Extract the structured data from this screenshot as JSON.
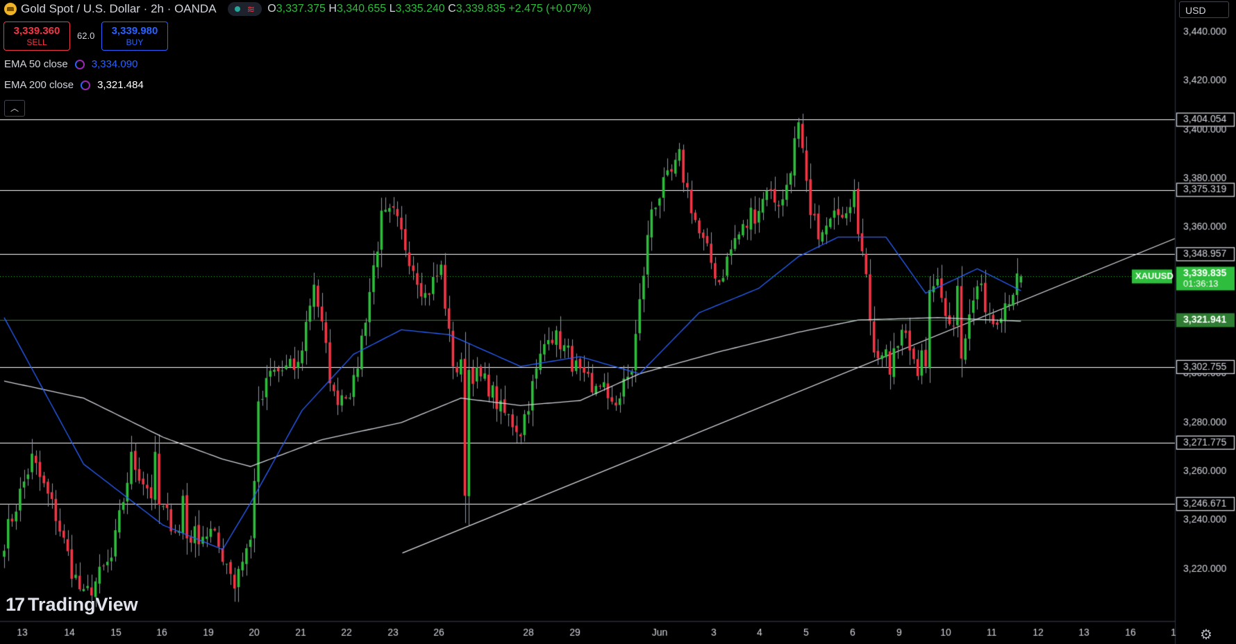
{
  "header": {
    "symbol_title": "Gold Spot / U.S. Dollar · 2h · OANDA",
    "ohlc": {
      "o_label": "O",
      "o": "3,337.375",
      "h_label": "H",
      "h": "3,340.655",
      "l_label": "L",
      "l": "3,335.240",
      "c_label": "C",
      "c": "3,339.835",
      "change": "+2.475 (+0.07%)"
    }
  },
  "trade": {
    "sell_price": "3,339.360",
    "sell_label": "SELL",
    "spread": "62.0",
    "buy_price": "3,339.980",
    "buy_label": "BUY"
  },
  "indicators": [
    {
      "label": "EMA 50 close",
      "value": "3,334.090",
      "color": "#2962ff"
    },
    {
      "label": "EMA 200 close",
      "value": "3,321.484",
      "color": "#d1d4dc"
    }
  ],
  "collapse_icon": "chevron-up-icon",
  "currency": "USD",
  "watermark": "TradingView",
  "settings_icon": "gear-icon",
  "colors": {
    "up": "#2ebd3c",
    "down": "#f23645",
    "ema50": "#2962ff",
    "ema200": "#d1d4dc",
    "level": "#ffffff",
    "price": "#2ebd3c"
  },
  "chart_data": {
    "type": "candlestick",
    "symbol": "XAUUSD",
    "ylim": [
      3200,
      3450
    ],
    "y_ticks": [
      "3,220.000",
      "3,240.000",
      "3,260.000",
      "3,280.000",
      "3,300.000",
      "3,360.000",
      "3,380.000",
      "3,400.000",
      "3,420.000",
      "3,440.000"
    ],
    "x_ticks": [
      "13",
      "14",
      "15",
      "16",
      "19",
      "20",
      "21",
      "22",
      "23",
      "26",
      "28",
      "29",
      "Jun",
      "3",
      "4",
      "5",
      "6",
      "9",
      "10",
      "11",
      "12",
      "13",
      "16",
      "1"
    ],
    "levels": [
      {
        "value": 3404.054,
        "label": "3,404.054"
      },
      {
        "value": 3375.319,
        "label": "3,375.319"
      },
      {
        "value": 3348.957,
        "label": "3,348.957"
      },
      {
        "value": 3321.941,
        "label": "3,321.941",
        "highlight": true
      },
      {
        "value": 3302.755,
        "label": "3,302.755"
      },
      {
        "value": 3271.775,
        "label": "3,271.775"
      },
      {
        "value": 3246.671,
        "label": "3,246.671"
      }
    ],
    "current_price": {
      "value": 3339.835,
      "label": "3,339.835",
      "countdown": "01:36:13",
      "symbol": "XAUUSD"
    },
    "trendline": {
      "from": {
        "bar": 116,
        "price": 3237
      },
      "to": {
        "bar": 267,
        "price": 3337
      }
    },
    "ema50_anchors": [
      [
        0,
        3323
      ],
      [
        20,
        3263
      ],
      [
        40,
        3238
      ],
      [
        55,
        3228
      ],
      [
        62,
        3247
      ],
      [
        75,
        3285
      ],
      [
        88,
        3308
      ],
      [
        100,
        3318
      ],
      [
        112,
        3316
      ],
      [
        130,
        3303
      ],
      [
        145,
        3307
      ],
      [
        160,
        3300
      ],
      [
        175,
        3325
      ],
      [
        190,
        3335
      ],
      [
        200,
        3348
      ],
      [
        210,
        3356
      ],
      [
        222,
        3356
      ],
      [
        232,
        3333
      ],
      [
        245,
        3343
      ],
      [
        256,
        3334
      ]
    ],
    "ema200_anchors": [
      [
        0,
        3297
      ],
      [
        20,
        3290
      ],
      [
        40,
        3274
      ],
      [
        55,
        3265
      ],
      [
        62,
        3262
      ],
      [
        80,
        3273
      ],
      [
        100,
        3280
      ],
      [
        115,
        3290
      ],
      [
        130,
        3287
      ],
      [
        145,
        3289
      ],
      [
        160,
        3300
      ],
      [
        180,
        3309
      ],
      [
        200,
        3317
      ],
      [
        215,
        3322
      ],
      [
        235,
        3323
      ],
      [
        256,
        3321.5
      ]
    ],
    "close_anchors": [
      [
        0,
        3232
      ],
      [
        7,
        3265
      ],
      [
        13,
        3242
      ],
      [
        17,
        3220
      ],
      [
        20,
        3208
      ],
      [
        27,
        3224
      ],
      [
        32,
        3265
      ],
      [
        38,
        3248
      ],
      [
        45,
        3233
      ],
      [
        52,
        3235
      ],
      [
        58,
        3217
      ],
      [
        62,
        3232
      ],
      [
        64,
        3285
      ],
      [
        67,
        3300
      ],
      [
        74,
        3303
      ],
      [
        78,
        3338
      ],
      [
        83,
        3290
      ],
      [
        88,
        3295
      ],
      [
        95,
        3363
      ],
      [
        98,
        3365
      ],
      [
        106,
        3332
      ],
      [
        110,
        3343
      ],
      [
        113,
        3301
      ],
      [
        116,
        3303
      ],
      [
        122,
        3295
      ],
      [
        125,
        3285
      ],
      [
        130,
        3277
      ],
      [
        137,
        3318
      ],
      [
        142,
        3308
      ],
      [
        148,
        3290
      ],
      [
        150,
        3297
      ],
      [
        154,
        3287
      ],
      [
        158,
        3302
      ],
      [
        163,
        3368
      ],
      [
        170,
        3387
      ],
      [
        175,
        3357
      ],
      [
        180,
        3338
      ],
      [
        184,
        3355
      ],
      [
        188,
        3363
      ],
      [
        192,
        3374
      ],
      [
        196,
        3370
      ],
      [
        200,
        3402
      ],
      [
        203,
        3362
      ],
      [
        206,
        3358
      ],
      [
        210,
        3365
      ],
      [
        214,
        3374
      ],
      [
        219,
        3312
      ],
      [
        223,
        3300
      ],
      [
        226,
        3318
      ],
      [
        230,
        3303
      ],
      [
        234,
        3339
      ],
      [
        238,
        3323
      ],
      [
        241,
        3310
      ],
      [
        245,
        3336
      ],
      [
        249,
        3322
      ],
      [
        256,
        3339.8
      ]
    ],
    "hard_points": [
      [
        38,
        3268
      ],
      [
        45,
        3250
      ],
      [
        58,
        3212
      ],
      [
        62,
        3232
      ],
      [
        98,
        3368
      ],
      [
        113,
        3303
      ],
      [
        116,
        3250
      ],
      [
        125,
        3289
      ],
      [
        140,
        3310
      ],
      [
        147,
        3300
      ],
      [
        149,
        3295
      ],
      [
        152,
        3290
      ],
      [
        154,
        3287
      ],
      [
        170,
        3392
      ],
      [
        188,
        3368
      ],
      [
        192,
        3375
      ],
      [
        200,
        3403
      ],
      [
        203,
        3365
      ],
      [
        206,
        3358
      ],
      [
        210,
        3365
      ],
      [
        214,
        3375
      ],
      [
        222,
        3310
      ],
      [
        226,
        3318
      ],
      [
        232,
        3303
      ],
      [
        240,
        3336
      ],
      [
        256,
        3339.835
      ]
    ],
    "candle_count": 257,
    "first_bar_x": 6,
    "bar_spacing": 5.72
  }
}
